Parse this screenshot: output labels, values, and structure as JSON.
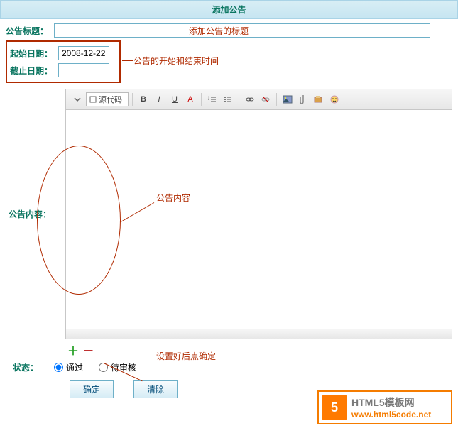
{
  "header": {
    "title": "添加公告"
  },
  "form": {
    "title_label": "公告标题：",
    "title_value": "",
    "start_date_label": "起始日期：",
    "start_date_value": "2008-12-22",
    "end_date_label": "截止日期：",
    "end_date_value": "",
    "content_label": "公告内容：",
    "status_label": "状态：",
    "status_options": {
      "pass": "通过",
      "pending": "待审核"
    }
  },
  "annotations": {
    "title": "添加公告的标题",
    "date": "公告的开始和结束时间",
    "content": "公告内容",
    "submit": "设置好后点确定"
  },
  "toolbar": {
    "source_label": "源代码",
    "bold": "B",
    "italic": "I",
    "underline": "U",
    "font": "A",
    "ol": "≡",
    "ul": "≡"
  },
  "plus_minus": {
    "plus": "＋",
    "minus": "－"
  },
  "buttons": {
    "ok": "确定",
    "clear": "清除"
  },
  "watermark": {
    "cn": "HTML5模板网",
    "url": "www.html5code.net",
    "logo": "5"
  },
  "bottom_watermark": " "
}
